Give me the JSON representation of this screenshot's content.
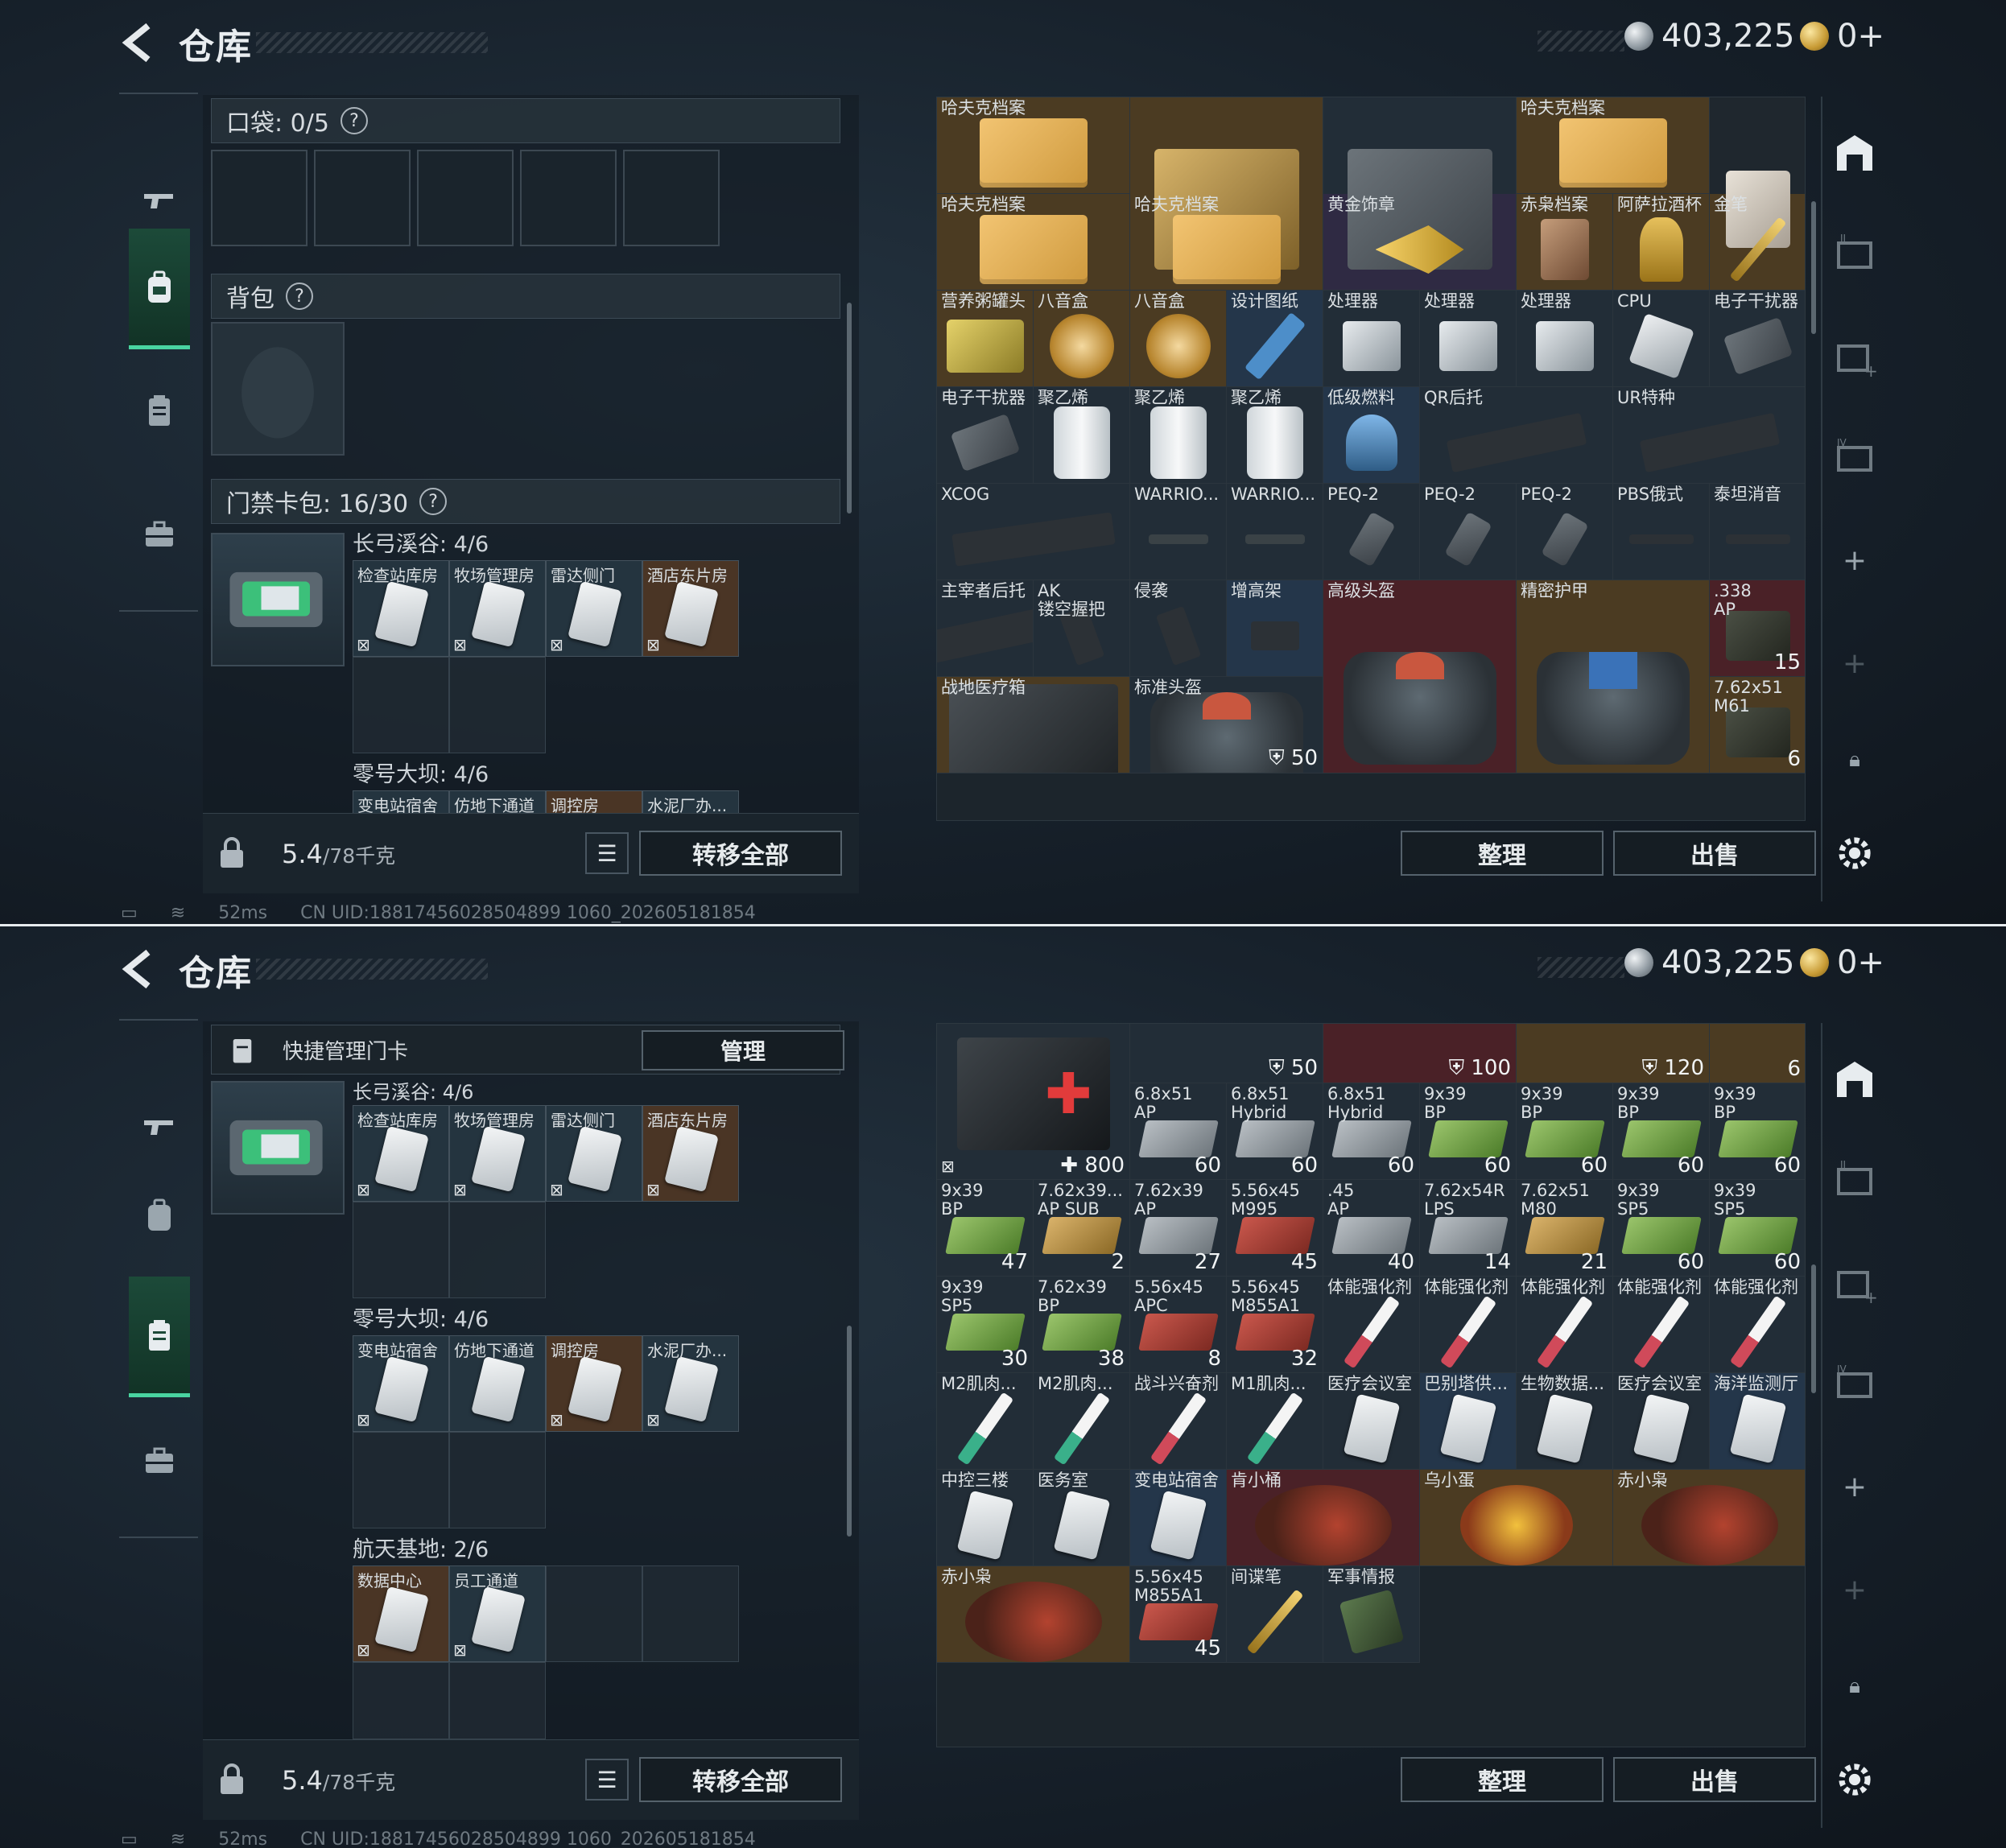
{
  "header": {
    "title": "仓库",
    "currency_silver": "403,225",
    "currency_gold": "0+"
  },
  "colors": {
    "accent_green": "#49d4a0",
    "slot_blue": "#24364a",
    "slot_purple": "#2f2a43",
    "slot_gold": "#4b3b22",
    "slot_red": "#4a2127"
  },
  "top": {
    "pocket_label": "口袋: 0/5",
    "backpack_label": "背包",
    "keycase_label": "门禁卡包: 16/30",
    "group1_title": "长弓溪谷: 4/6",
    "group1_cards": [
      "检查站库房",
      "牧场管理房",
      "雷达侧门",
      "酒店东片房"
    ],
    "group2_title": "零号大坝: 4/6",
    "group2_cards_partial": [
      "变电站宿舍",
      "仿地下通道",
      "调控房",
      "水泥厂办..."
    ],
    "weight_value": "5.4",
    "weight_max": "/78千克",
    "transfer_all": "转移全部",
    "sort_button": "整理",
    "sell_button": "出售",
    "items": [
      {
        "name": "哈夫克档案",
        "icon": "folder-icon"
      },
      {
        "name": "",
        "icon": "crate-icon"
      },
      {
        "name": "",
        "icon": "toolbox-icon"
      },
      {
        "name": "哈夫克档案",
        "icon": "folder-icon"
      },
      {
        "name": "",
        "icon": "barista-box-icon"
      },
      {
        "name": "哈夫克档案",
        "icon": "folder-icon"
      },
      {
        "name": "哈夫克档案",
        "icon": "folder-icon"
      },
      {
        "name": "黄金饰章",
        "icon": "golden-badge-icon"
      },
      {
        "name": "赤枭档案",
        "icon": "photo-icon"
      },
      {
        "name": "阿萨拉酒杯",
        "icon": "goblet-icon"
      },
      {
        "name": "金笔",
        "icon": "pen-icon"
      },
      {
        "name": "营养粥罐头",
        "icon": "can-icon"
      },
      {
        "name": "八音盒",
        "icon": "music-box-icon"
      },
      {
        "name": "八音盒",
        "icon": "music-box-icon"
      },
      {
        "name": "设计图纸",
        "icon": "blueprint-icon"
      },
      {
        "name": "处理器",
        "icon": "processor-icon"
      },
      {
        "name": "处理器",
        "icon": "processor-icon"
      },
      {
        "name": "处理器",
        "icon": "processor-icon"
      },
      {
        "name": "CPU",
        "icon": "cpu-icon"
      },
      {
        "name": "电子干扰器",
        "icon": "jammer-icon"
      },
      {
        "name": "电子干扰器",
        "icon": "jammer-icon"
      },
      {
        "name": "聚乙烯",
        "icon": "polyethylene-icon"
      },
      {
        "name": "聚乙烯",
        "icon": "polyethylene-icon"
      },
      {
        "name": "聚乙烯",
        "icon": "polyethylene-icon"
      },
      {
        "name": "低级燃料",
        "icon": "fuel-icon"
      },
      {
        "name": "QR后托",
        "icon": "stock-icon"
      },
      {
        "name": "UR特种",
        "icon": "stock-icon"
      },
      {
        "name": "XCOG",
        "icon": "scope-icon"
      },
      {
        "name": "WARRIO...",
        "icon": "flashlight-icon"
      },
      {
        "name": "WARRIO...",
        "icon": "flashlight-icon"
      },
      {
        "name": "PEQ-2",
        "icon": "laser-icon"
      },
      {
        "name": "PEQ-2",
        "icon": "laser-icon"
      },
      {
        "name": "PEQ-2",
        "icon": "laser-icon"
      },
      {
        "name": "PBS俄式",
        "icon": "suppressor-icon"
      },
      {
        "name": "泰坦消音",
        "icon": "suppressor-icon"
      },
      {
        "name": "主宰者后托",
        "icon": "stock-icon"
      },
      {
        "name": "AK\n镂空握把",
        "icon": "grip-icon"
      },
      {
        "name": "侵袭",
        "icon": "grip-icon"
      },
      {
        "name": "增高架",
        "icon": "mount-icon"
      },
      {
        "name": "高级头盔",
        "icon": "helmet-bag-icon"
      },
      {
        "name": "精密护甲",
        "icon": "armor-bag-icon"
      },
      {
        "name": ".338\nAP",
        "count": "15",
        "icon": "ammo-box-icon"
      },
      {
        "name": "战地医疗箱",
        "icon": "medkit-icon"
      },
      {
        "name": "标准头盔",
        "icon": "helmet-bag-icon",
        "durability": "50"
      },
      {
        "name": "",
        "durability": "100"
      },
      {
        "name": "",
        "durability": "120"
      },
      {
        "name": "7.62x51\nM61",
        "count": "6",
        "icon": "ammo-box-icon"
      }
    ]
  },
  "bottom": {
    "manage_bar_label": "快捷管理门卡",
    "manage_button": "管理",
    "group1_title": "长弓溪谷: 4/6",
    "group1_cards": [
      "检查站库房",
      "牧场管理房",
      "雷达侧门",
      "酒店东片房"
    ],
    "group2_title": "零号大坝: 4/6",
    "group2_cards": [
      "变电站宿舍",
      "仿地下通道",
      "调控房",
      "水泥厂办..."
    ],
    "group3_title": "航天基地: 2/6",
    "group3_cards": [
      "数据中心",
      "员工通道"
    ],
    "weight_value": "5.4",
    "weight_max": "/78千克",
    "transfer_all": "转移全部",
    "sort_button": "整理",
    "sell_button": "出售",
    "partial_row": [
      {
        "durability": "50"
      },
      {
        "durability": "100"
      },
      {
        "durability": "120"
      },
      {
        "count": "6"
      }
    ],
    "medkit_durability": "800",
    "items": [
      {
        "name": "6.8x51\nAP",
        "count": "60",
        "ammo": "gray"
      },
      {
        "name": "6.8x51\nHybrid",
        "count": "60",
        "ammo": "gray"
      },
      {
        "name": "6.8x51\nHybrid",
        "count": "60",
        "ammo": "gray"
      },
      {
        "name": "9x39\nBP",
        "count": "60",
        "ammo": "green"
      },
      {
        "name": "9x39\nBP",
        "count": "60",
        "ammo": "green"
      },
      {
        "name": "9x39\nBP",
        "count": "60",
        "ammo": "green"
      },
      {
        "name": "9x39\nBP",
        "count": "60",
        "ammo": "green"
      },
      {
        "name": "9x39\nBP",
        "count": "47",
        "ammo": "green"
      },
      {
        "name": "7.62x39...\nAP SUB",
        "count": "2",
        "ammo": "gold"
      },
      {
        "name": "7.62x39\nAP",
        "count": "27",
        "ammo": "gray"
      },
      {
        "name": "5.56x45\nM995",
        "count": "45",
        "ammo": "red"
      },
      {
        "name": ".45\nAP",
        "count": "40",
        "ammo": "gray"
      },
      {
        "name": "7.62x54R\nLPS",
        "count": "14",
        "ammo": "gray"
      },
      {
        "name": "7.62x51\nM80",
        "count": "21",
        "ammo": "gold"
      },
      {
        "name": "9x39\nSP5",
        "count": "60",
        "ammo": "green"
      },
      {
        "name": "9x39\nSP5",
        "count": "60",
        "ammo": "green"
      },
      {
        "name": "9x39\nSP5",
        "count": "30",
        "ammo": "green"
      },
      {
        "name": "7.62x39\nBP",
        "count": "38",
        "ammo": "green"
      },
      {
        "name": "5.56x45\nAPC",
        "count": "8",
        "ammo": "red"
      },
      {
        "name": "5.56x45\nM855A1",
        "count": "32",
        "ammo": "red"
      },
      {
        "name": "体能强化剂",
        "icon": "syringe-icon"
      },
      {
        "name": "体能强化剂",
        "icon": "syringe-icon"
      },
      {
        "name": "体能强化剂",
        "icon": "syringe-icon"
      },
      {
        "name": "体能强化剂",
        "icon": "syringe-icon"
      },
      {
        "name": "体能强化剂",
        "icon": "syringe-icon"
      },
      {
        "name": "M2肌肉...",
        "icon": "syringe-green-icon"
      },
      {
        "name": "M2肌肉...",
        "icon": "syringe-green-icon"
      },
      {
        "name": "战斗兴奋剂",
        "icon": "syringe-icon"
      },
      {
        "name": "M1肌肉...",
        "icon": "syringe-green-icon"
      },
      {
        "name": "医疗会议室",
        "icon": "keycard-icon"
      },
      {
        "name": "巴别塔供...",
        "icon": "keycard-icon"
      },
      {
        "name": "生物数据...",
        "icon": "keycard-icon"
      },
      {
        "name": "医疗会议室",
        "icon": "keycard-icon"
      },
      {
        "name": "海洋监测厅",
        "icon": "keycard-icon"
      },
      {
        "name": "中控三楼",
        "icon": "keycard-icon"
      },
      {
        "name": "医务室",
        "icon": "keycard-icon"
      },
      {
        "name": "变电站宿舍",
        "icon": "keycard-icon"
      },
      {
        "name": "肯小桶",
        "icon": "figurine-icon"
      },
      {
        "name": "乌小蛋",
        "icon": "egg-figurine-icon"
      },
      {
        "name": "赤小枭",
        "icon": "figurine-icon"
      },
      {
        "name": "赤小枭",
        "icon": "figurine-icon"
      },
      {
        "name": "5.56x45\nM855A1",
        "count": "45",
        "ammo": "red"
      },
      {
        "name": "间谍笔",
        "icon": "pen-icon"
      },
      {
        "name": "军事情报",
        "icon": "intel-chip-icon"
      }
    ]
  },
  "status": {
    "ping": "52ms",
    "uid": "CN UID:18817456028504899 1060_202605181854"
  }
}
